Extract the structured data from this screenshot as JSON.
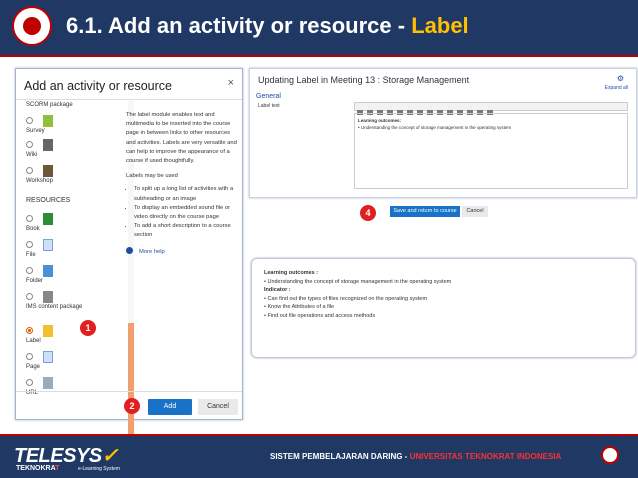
{
  "header": {
    "title_prefix": "6.1. Add an activity or resource - ",
    "title_highlight": "Label"
  },
  "modal": {
    "title": "Add an activity or resource",
    "close": "×",
    "items": [
      {
        "label": "SCORM package"
      },
      {
        "label": "Survey"
      },
      {
        "label": "Wiki"
      },
      {
        "label": "Workshop"
      }
    ],
    "resources_heading": "RESOURCES",
    "resources": [
      {
        "label": "Book"
      },
      {
        "label": "File"
      },
      {
        "label": "Folder"
      },
      {
        "label": "IMS content package"
      },
      {
        "label": "Label",
        "selected": true
      },
      {
        "label": "Page"
      },
      {
        "label": "URL"
      }
    ],
    "description": "The label module enables text and multimedia to be inserted into the course page in between links to other resources and activities. Labels are very versatile and can help to improve the appearance of a course if used thoughtfully.",
    "may_be_used": "Labels may be used",
    "uses": [
      "To split up a long list of activities with a subheading or an image",
      "To display an embedded sound file or video directly on the course page",
      "To add a short description to a course section"
    ],
    "more_help": "More help",
    "add_button": "Add",
    "cancel_button": "Cancel"
  },
  "editor": {
    "title": "Updating Label in Meeting 13 : Storage Management",
    "expand_all": "Expand all",
    "general": "General",
    "label_text": "Label text",
    "content_heading": "Learning outcomes:",
    "content_line": "Understanding the concept of storage management in the operating system",
    "save_button": "Save and return to course",
    "cancel_button": "Cancel"
  },
  "preview": {
    "outcomes_heading": "Learning outcomes :",
    "outcome": "Understanding the concept of storage management in the operating system",
    "indicator_heading": "Indicator :",
    "indicators": [
      "Can find out the types of files recognized on the operating system",
      "Know the Attributes of a file",
      "Find out file operations and access methods"
    ]
  },
  "badges": {
    "b1": "1",
    "b2": "2",
    "b4": "4"
  },
  "footer": {
    "brand_main": "TELESYS",
    "brand_sub_a": "TEKNOKRA",
    "brand_sub_b": "T",
    "tagline": "e-Learning System",
    "right_a": "SISTEM PEMBELAJARAN DARING - ",
    "right_b": "UNIVERSITAS TEKNOKRAT INDONESIA"
  },
  "colors": {
    "header_bg": "#1f3864",
    "accent": "#ffc000",
    "primary_button": "#1873c8",
    "badge": "#e02020"
  }
}
